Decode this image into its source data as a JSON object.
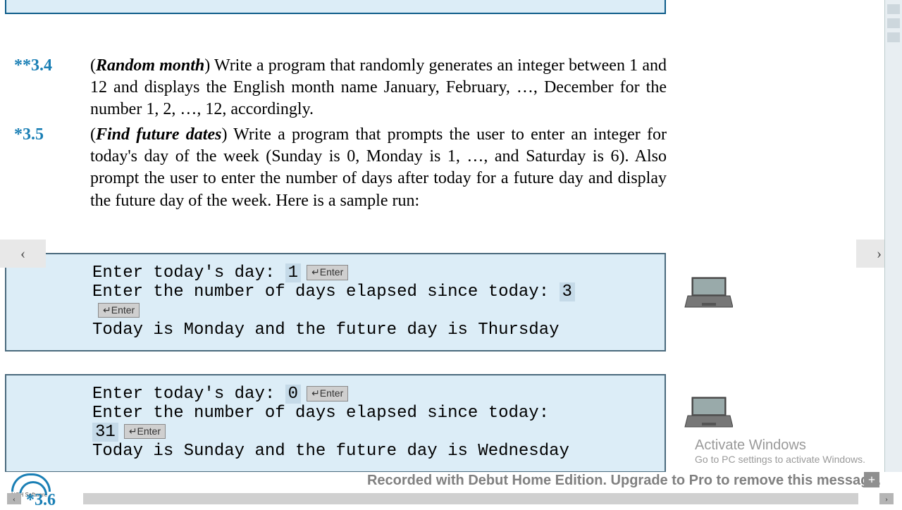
{
  "exercises": {
    "ex34": {
      "number": "**3.4",
      "title": "Random month",
      "body": ") Write a program that randomly generates an integer between 1 and 12 and displays the English month name January, February, …, December for the number 1, 2, …, 12, accordingly."
    },
    "ex35": {
      "number": "*3.5",
      "title": "Find future dates",
      "body": ") Write a program that prompts the user to enter an integer for today's day of the week (Sunday is 0, Monday is 1, …, and Saturday is 6). Also prompt the user to enter the number of days after today for a future day and display the future day of the week. Here is a sample run:"
    },
    "ex36_partial": "*3.6"
  },
  "console1": {
    "line1a": "Enter today's day: ",
    "input1": "1",
    "line2a": "Enter the number of days elapsed since today: ",
    "input2": "3",
    "line3": "Today is Monday and the future day is Thursday"
  },
  "console2": {
    "line1a": "Enter today's day: ",
    "input1": "0",
    "line2a": "Enter the number of days elapsed since today: ",
    "input2": "31",
    "line3": "Today is Sunday and the future day is Wednesday"
  },
  "enter_label": "↵Enter",
  "nav": {
    "prev": "‹",
    "next": "›"
  },
  "watermark": {
    "line1": "Activate Windows",
    "line2": "Go to PC settings to activate Windows."
  },
  "debut": "Recorded with Debut Home Edition. Upgrade to Pro to remove this message.",
  "nch": "NCH Software",
  "plus": "+"
}
